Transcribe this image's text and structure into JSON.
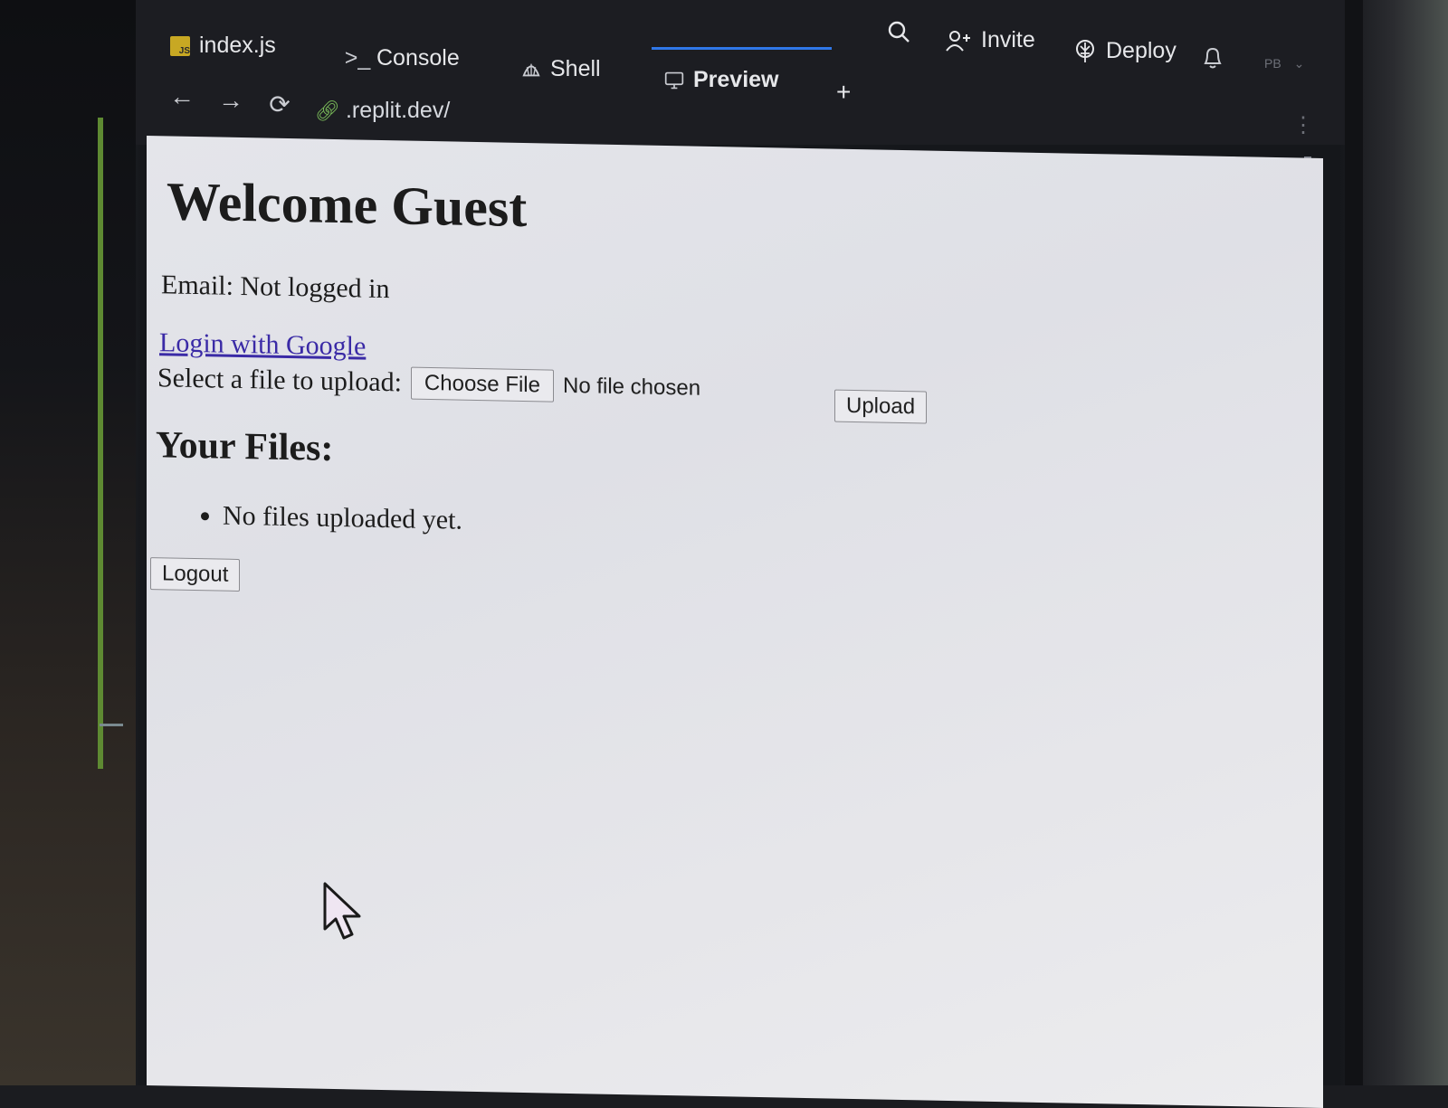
{
  "ide": {
    "tabs": [
      {
        "label": "index.js",
        "icon": "javascript-file-icon",
        "active": false
      },
      {
        "label": "Console",
        "icon": "terminal-icon",
        "active": false
      },
      {
        "label": "Shell",
        "icon": "shell-icon",
        "active": false
      },
      {
        "label": "Preview",
        "icon": "monitor-icon",
        "active": true
      }
    ],
    "add_tab": "+",
    "search_icon": "search-icon",
    "invite_label": "Invite",
    "deploy_label": "Deploy",
    "avatar_initials": "PB",
    "address_bar": {
      "url": ".replit.dev/"
    }
  },
  "page": {
    "title": "Welcome Guest",
    "email_line": "Email: Not logged in",
    "google_link": "Login with Google",
    "upload_prompt": "Select a file to upload:",
    "choose_file_label": "Choose File",
    "no_file_text": "No file chosen",
    "upload_button": "Upload",
    "files_heading": "Your Files:",
    "files": [
      "No files uploaded yet."
    ],
    "logout_button": "Logout"
  },
  "colors": {
    "ide_bg": "#1c1d22",
    "active_tab_accent": "#2f77e8",
    "link": "#3a2aa6",
    "page_bg": "#e4e5ea"
  }
}
